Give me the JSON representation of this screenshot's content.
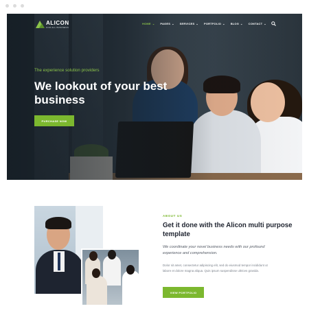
{
  "nav": {
    "logo_name": "ALICON",
    "logo_tagline": "FOR ALL BUSINESS",
    "menu": [
      {
        "label": "HOME",
        "has_caret": true,
        "active": true
      },
      {
        "label": "PAGES",
        "has_caret": true,
        "active": false
      },
      {
        "label": "SERVICES",
        "has_caret": true,
        "active": false
      },
      {
        "label": "PORTFOLIO",
        "has_caret": true,
        "active": false
      },
      {
        "label": "BLOG",
        "has_caret": true,
        "active": false
      },
      {
        "label": "CONTACT",
        "has_caret": true,
        "active": false
      }
    ],
    "caret_glyph": "⌄",
    "search_icon": "search-icon"
  },
  "hero": {
    "eyebrow": "The experience solution providers",
    "title": "We lookout of your best business",
    "button_label": "PURCHASE NOW"
  },
  "about": {
    "eyebrow": "ABOUT US",
    "title": "Get it done with the Alicon multi purpose template",
    "lead": "We coordinate your novel business needs with our profound experience and comprehension.",
    "body": "Dolor sit amet, consectetur adipiscing elit, sed do eiusmod tempor incididunt ut labore et dolore magna aliqua. Quis ipsum suspendisse ultrices gravida.",
    "button_label": "VIEW PORTFOLIO"
  },
  "colors": {
    "accent": "#7cb82f",
    "heading": "#1f2430",
    "hero_overlay": "#141c23"
  }
}
